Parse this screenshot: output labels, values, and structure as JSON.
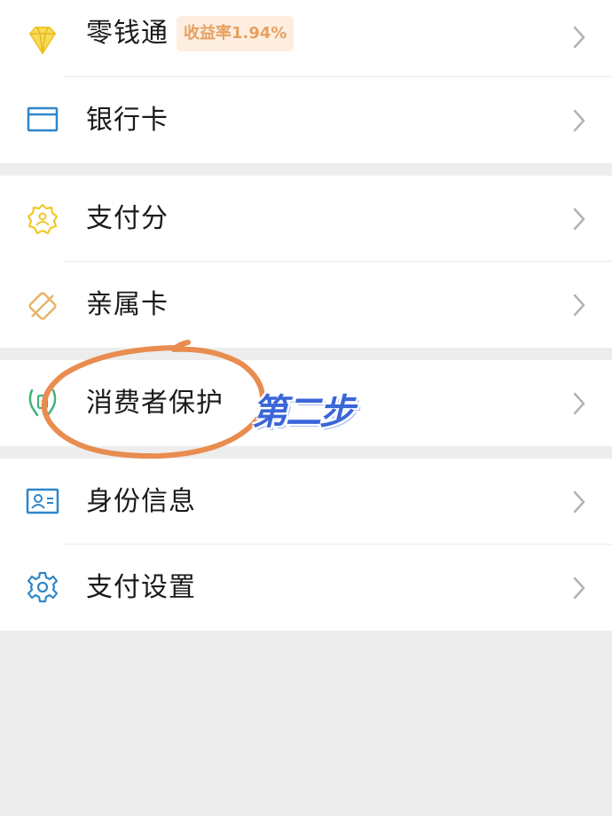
{
  "groups": [
    {
      "items": [
        {
          "label": "零钱通",
          "icon": "diamond-icon",
          "badge": "收益率1.94%"
        },
        {
          "label": "银行卡",
          "icon": "bank-card-icon"
        }
      ]
    },
    {
      "items": [
        {
          "label": "支付分",
          "icon": "badge-person-icon"
        },
        {
          "label": "亲属卡",
          "icon": "family-card-icon"
        }
      ]
    },
    {
      "items": [
        {
          "label": "消费者保护",
          "icon": "hands-protect-icon"
        }
      ]
    },
    {
      "items": [
        {
          "label": "身份信息",
          "icon": "id-card-icon"
        },
        {
          "label": "支付设置",
          "icon": "gear-icon"
        }
      ]
    }
  ],
  "annotation": {
    "text": "第二步",
    "circle_color": "#e98c4f"
  },
  "colors": {
    "yellow": "#f2c72a",
    "blue": "#2f86c9",
    "green": "#3fb37a",
    "orange": "#e98c4f",
    "background": "#ededed"
  }
}
